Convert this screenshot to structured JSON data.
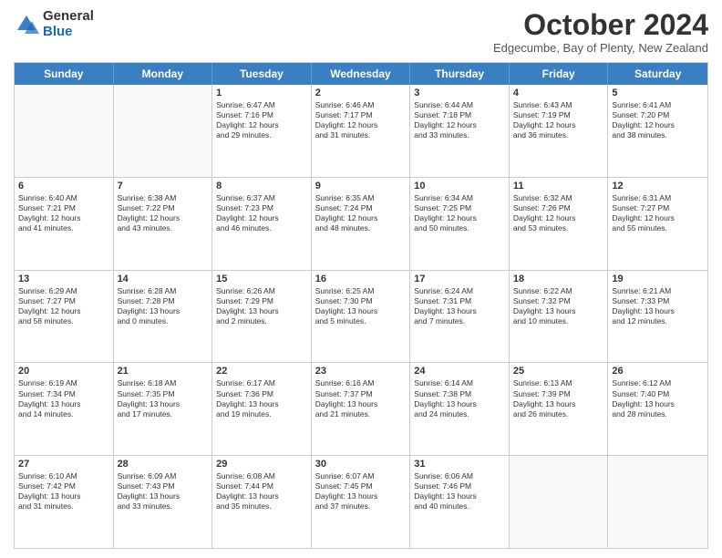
{
  "logo": {
    "general": "General",
    "blue": "Blue"
  },
  "header": {
    "month": "October 2024",
    "subtitle": "Edgecumbe, Bay of Plenty, New Zealand"
  },
  "weekdays": [
    "Sunday",
    "Monday",
    "Tuesday",
    "Wednesday",
    "Thursday",
    "Friday",
    "Saturday"
  ],
  "weeks": [
    [
      {
        "day": "",
        "lines": []
      },
      {
        "day": "",
        "lines": []
      },
      {
        "day": "1",
        "lines": [
          "Sunrise: 6:47 AM",
          "Sunset: 7:16 PM",
          "Daylight: 12 hours",
          "and 29 minutes."
        ]
      },
      {
        "day": "2",
        "lines": [
          "Sunrise: 6:46 AM",
          "Sunset: 7:17 PM",
          "Daylight: 12 hours",
          "and 31 minutes."
        ]
      },
      {
        "day": "3",
        "lines": [
          "Sunrise: 6:44 AM",
          "Sunset: 7:18 PM",
          "Daylight: 12 hours",
          "and 33 minutes."
        ]
      },
      {
        "day": "4",
        "lines": [
          "Sunrise: 6:43 AM",
          "Sunset: 7:19 PM",
          "Daylight: 12 hours",
          "and 36 minutes."
        ]
      },
      {
        "day": "5",
        "lines": [
          "Sunrise: 6:41 AM",
          "Sunset: 7:20 PM",
          "Daylight: 12 hours",
          "and 38 minutes."
        ]
      }
    ],
    [
      {
        "day": "6",
        "lines": [
          "Sunrise: 6:40 AM",
          "Sunset: 7:21 PM",
          "Daylight: 12 hours",
          "and 41 minutes."
        ]
      },
      {
        "day": "7",
        "lines": [
          "Sunrise: 6:38 AM",
          "Sunset: 7:22 PM",
          "Daylight: 12 hours",
          "and 43 minutes."
        ]
      },
      {
        "day": "8",
        "lines": [
          "Sunrise: 6:37 AM",
          "Sunset: 7:23 PM",
          "Daylight: 12 hours",
          "and 46 minutes."
        ]
      },
      {
        "day": "9",
        "lines": [
          "Sunrise: 6:35 AM",
          "Sunset: 7:24 PM",
          "Daylight: 12 hours",
          "and 48 minutes."
        ]
      },
      {
        "day": "10",
        "lines": [
          "Sunrise: 6:34 AM",
          "Sunset: 7:25 PM",
          "Daylight: 12 hours",
          "and 50 minutes."
        ]
      },
      {
        "day": "11",
        "lines": [
          "Sunrise: 6:32 AM",
          "Sunset: 7:26 PM",
          "Daylight: 12 hours",
          "and 53 minutes."
        ]
      },
      {
        "day": "12",
        "lines": [
          "Sunrise: 6:31 AM",
          "Sunset: 7:27 PM",
          "Daylight: 12 hours",
          "and 55 minutes."
        ]
      }
    ],
    [
      {
        "day": "13",
        "lines": [
          "Sunrise: 6:29 AM",
          "Sunset: 7:27 PM",
          "Daylight: 12 hours",
          "and 58 minutes."
        ]
      },
      {
        "day": "14",
        "lines": [
          "Sunrise: 6:28 AM",
          "Sunset: 7:28 PM",
          "Daylight: 13 hours",
          "and 0 minutes."
        ]
      },
      {
        "day": "15",
        "lines": [
          "Sunrise: 6:26 AM",
          "Sunset: 7:29 PM",
          "Daylight: 13 hours",
          "and 2 minutes."
        ]
      },
      {
        "day": "16",
        "lines": [
          "Sunrise: 6:25 AM",
          "Sunset: 7:30 PM",
          "Daylight: 13 hours",
          "and 5 minutes."
        ]
      },
      {
        "day": "17",
        "lines": [
          "Sunrise: 6:24 AM",
          "Sunset: 7:31 PM",
          "Daylight: 13 hours",
          "and 7 minutes."
        ]
      },
      {
        "day": "18",
        "lines": [
          "Sunrise: 6:22 AM",
          "Sunset: 7:32 PM",
          "Daylight: 13 hours",
          "and 10 minutes."
        ]
      },
      {
        "day": "19",
        "lines": [
          "Sunrise: 6:21 AM",
          "Sunset: 7:33 PM",
          "Daylight: 13 hours",
          "and 12 minutes."
        ]
      }
    ],
    [
      {
        "day": "20",
        "lines": [
          "Sunrise: 6:19 AM",
          "Sunset: 7:34 PM",
          "Daylight: 13 hours",
          "and 14 minutes."
        ]
      },
      {
        "day": "21",
        "lines": [
          "Sunrise: 6:18 AM",
          "Sunset: 7:35 PM",
          "Daylight: 13 hours",
          "and 17 minutes."
        ]
      },
      {
        "day": "22",
        "lines": [
          "Sunrise: 6:17 AM",
          "Sunset: 7:36 PM",
          "Daylight: 13 hours",
          "and 19 minutes."
        ]
      },
      {
        "day": "23",
        "lines": [
          "Sunrise: 6:16 AM",
          "Sunset: 7:37 PM",
          "Daylight: 13 hours",
          "and 21 minutes."
        ]
      },
      {
        "day": "24",
        "lines": [
          "Sunrise: 6:14 AM",
          "Sunset: 7:38 PM",
          "Daylight: 13 hours",
          "and 24 minutes."
        ]
      },
      {
        "day": "25",
        "lines": [
          "Sunrise: 6:13 AM",
          "Sunset: 7:39 PM",
          "Daylight: 13 hours",
          "and 26 minutes."
        ]
      },
      {
        "day": "26",
        "lines": [
          "Sunrise: 6:12 AM",
          "Sunset: 7:40 PM",
          "Daylight: 13 hours",
          "and 28 minutes."
        ]
      }
    ],
    [
      {
        "day": "27",
        "lines": [
          "Sunrise: 6:10 AM",
          "Sunset: 7:42 PM",
          "Daylight: 13 hours",
          "and 31 minutes."
        ]
      },
      {
        "day": "28",
        "lines": [
          "Sunrise: 6:09 AM",
          "Sunset: 7:43 PM",
          "Daylight: 13 hours",
          "and 33 minutes."
        ]
      },
      {
        "day": "29",
        "lines": [
          "Sunrise: 6:08 AM",
          "Sunset: 7:44 PM",
          "Daylight: 13 hours",
          "and 35 minutes."
        ]
      },
      {
        "day": "30",
        "lines": [
          "Sunrise: 6:07 AM",
          "Sunset: 7:45 PM",
          "Daylight: 13 hours",
          "and 37 minutes."
        ]
      },
      {
        "day": "31",
        "lines": [
          "Sunrise: 6:06 AM",
          "Sunset: 7:46 PM",
          "Daylight: 13 hours",
          "and 40 minutes."
        ]
      },
      {
        "day": "",
        "lines": []
      },
      {
        "day": "",
        "lines": []
      }
    ]
  ]
}
